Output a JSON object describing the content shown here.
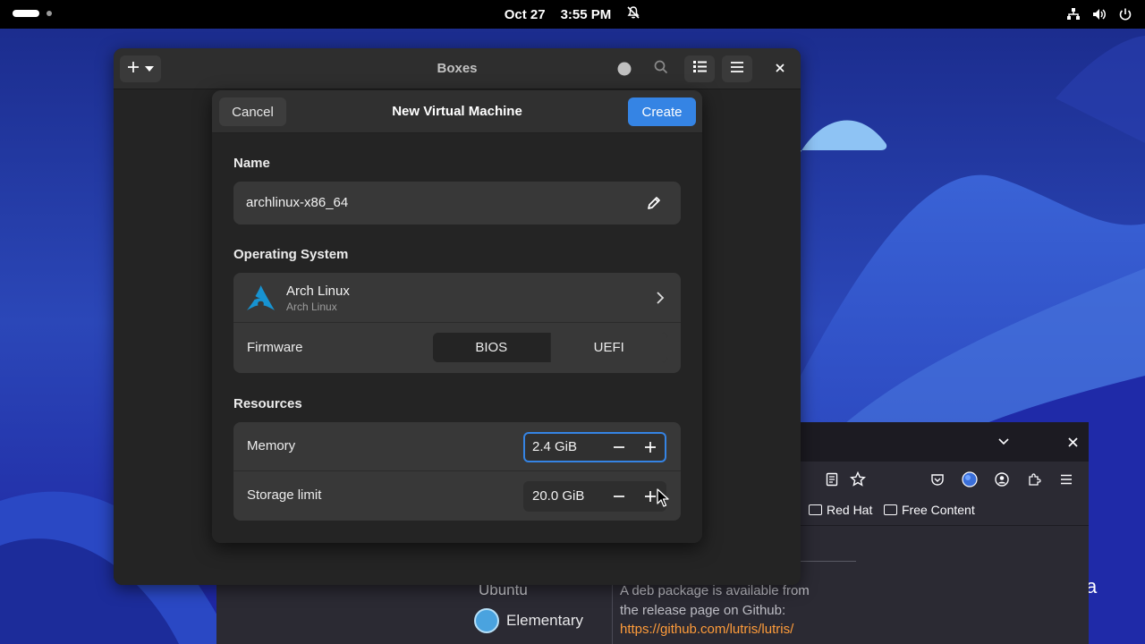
{
  "topbar": {
    "date": "Oct 27",
    "time": "3:55 PM",
    "icons": [
      "activities-indicator",
      "notifications-off-icon",
      "network-icon",
      "volume-icon",
      "power-icon"
    ]
  },
  "boxes": {
    "title": "Boxes",
    "header_icons": [
      "add-icon",
      "chevron-down-icon",
      "recording-indicator",
      "search-icon",
      "view-list-icon",
      "main-menu-icon",
      "close-icon"
    ]
  },
  "dialog": {
    "title": "New Virtual Machine",
    "cancel_label": "Cancel",
    "create_label": "Create",
    "name": {
      "label": "Name",
      "value": "archlinux-x86_64"
    },
    "os": {
      "label": "Operating System",
      "name": "Arch Linux",
      "subtitle": "Arch Linux",
      "firmware_label": "Firmware",
      "firmware_options": [
        "BIOS",
        "UEFI"
      ],
      "firmware_selected": "BIOS"
    },
    "resources": {
      "label": "Resources",
      "memory_label": "Memory",
      "memory_value": "2.4 GiB",
      "storage_label": "Storage limit",
      "storage_value": "20.0 GiB"
    }
  },
  "browser": {
    "bookmarks": [
      "Red Hat",
      "Free Content"
    ],
    "ubuntu": "Ubuntu",
    "elementary": "Elementary",
    "text_line1": "A deb package is available from",
    "text_line2": "the release page on Github:",
    "link": "https://github.com/lutris/lutris/",
    "side_letter": "a"
  },
  "colors": {
    "accent": "#3584e4",
    "wallpaper": "#1b1f8f",
    "link": "#ff9c3a"
  }
}
